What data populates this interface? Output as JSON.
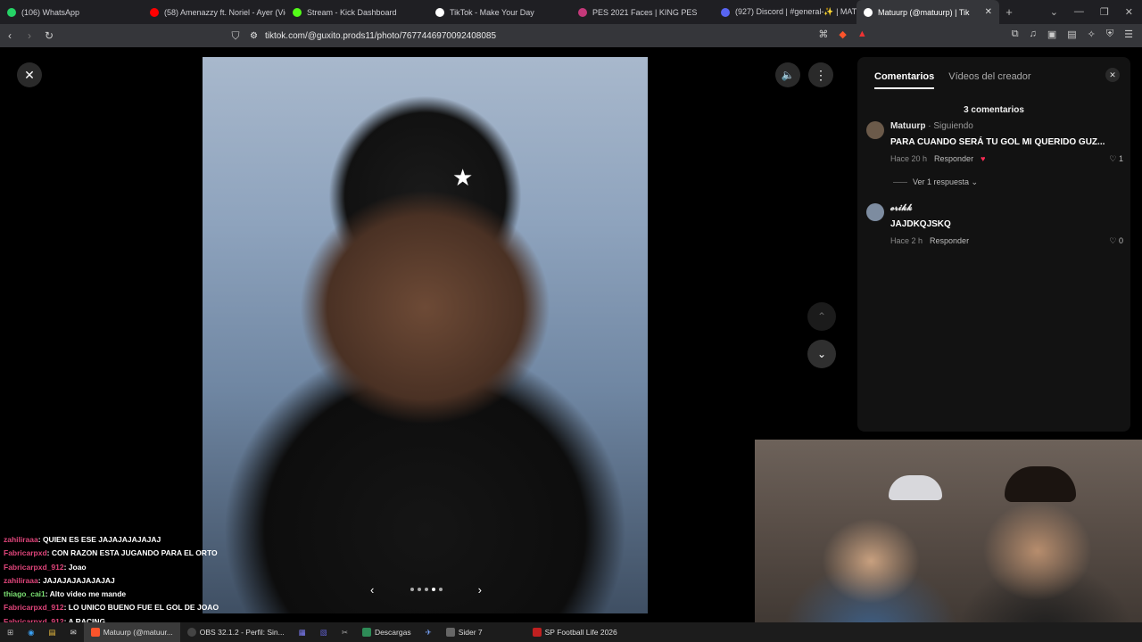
{
  "browser": {
    "tabs": [
      {
        "label": "(106) WhatsApp",
        "color": "#25d366"
      },
      {
        "label": "(58) Amenazzy ft. Noriel - Ayer (Vid",
        "color": "#ff0000"
      },
      {
        "label": "Stream - Kick Dashboard",
        "color": "#53fc18"
      },
      {
        "label": "TikTok - Make Your Day",
        "color": "#ffffff"
      },
      {
        "label": "PES 2021 Faces | KING PES",
        "color": "#c4397a"
      },
      {
        "label": "(927) Discord | #general-✨ | MAT",
        "color": "#5865f2"
      },
      {
        "label": "Matuurp (@matuurp) | Tik",
        "color": "#ffffff",
        "active": true
      }
    ],
    "new_tab": "+",
    "url": "tiktok.com/@guxito.prods11/photo/7677446970092408085"
  },
  "viewer": {
    "close_label": "✕",
    "sound_label": "🔈",
    "more_label": "⋮",
    "prev_label": "‹",
    "next_label": "›",
    "up_label": "⌃",
    "down_label": "⌄",
    "carousel_total": 5,
    "carousel_active": 4,
    "photo_logo": "★"
  },
  "comments_panel": {
    "tabs": [
      "Comentarios",
      "Vídeos del creador"
    ],
    "close_label": "✕",
    "count_label": "3 comentarios",
    "comments": [
      {
        "author": "Matuurp",
        "follow": " · Siguiendo",
        "text": "PARA CUANDO SERÁ TU GOL MI QUERIDO GUZ...",
        "time": "Hace 20 h",
        "reply": "Responder",
        "likes": "♡ 1"
      },
      {
        "author": "𝓮𝓻𝓲𝓴𝓴",
        "follow": "",
        "text": "JAJDKQJSKQ",
        "time": "Hace 2 h",
        "reply": "Responder",
        "likes": "♡ 0"
      }
    ],
    "see_reply": "Ver 1 respuesta ⌄"
  },
  "chat": [
    {
      "user": "zahiliraaa",
      "msg": ": QUIEN ES ESE JAJAJAJAJAJAJ",
      "green": false
    },
    {
      "user": "Fabricarpxd",
      "msg": ": CON RAZON ESTA JUGANDO PARA EL ORTO",
      "green": false
    },
    {
      "user": "Fabricarpxd_912",
      "msg": ": Joao",
      "green": false
    },
    {
      "user": "zahiliraaa",
      "msg": ": JAJAJAJAJAJAJAJ",
      "green": false
    },
    {
      "user": "thiago_cai1",
      "msg": ": Alto video me mande",
      "green": true
    },
    {
      "user": "Fabricarpxd_912",
      "msg": ": LO UNICO BUENO FUE EL GOL DE JOAO",
      "green": false
    },
    {
      "user": "Fabricarpxd_912",
      "msg": ": A RACING",
      "green": false
    }
  ],
  "taskbar": {
    "items": [
      {
        "label": "Matuurp (@matuur...",
        "active": true
      },
      {
        "label": "OBS 32.1.2 - Perfil: Sin...",
        "active": false
      },
      {
        "label": "Descargas",
        "active": false
      },
      {
        "label": "Sider 7",
        "active": false
      },
      {
        "label": "SP Football Life 2026",
        "active": false
      }
    ]
  }
}
